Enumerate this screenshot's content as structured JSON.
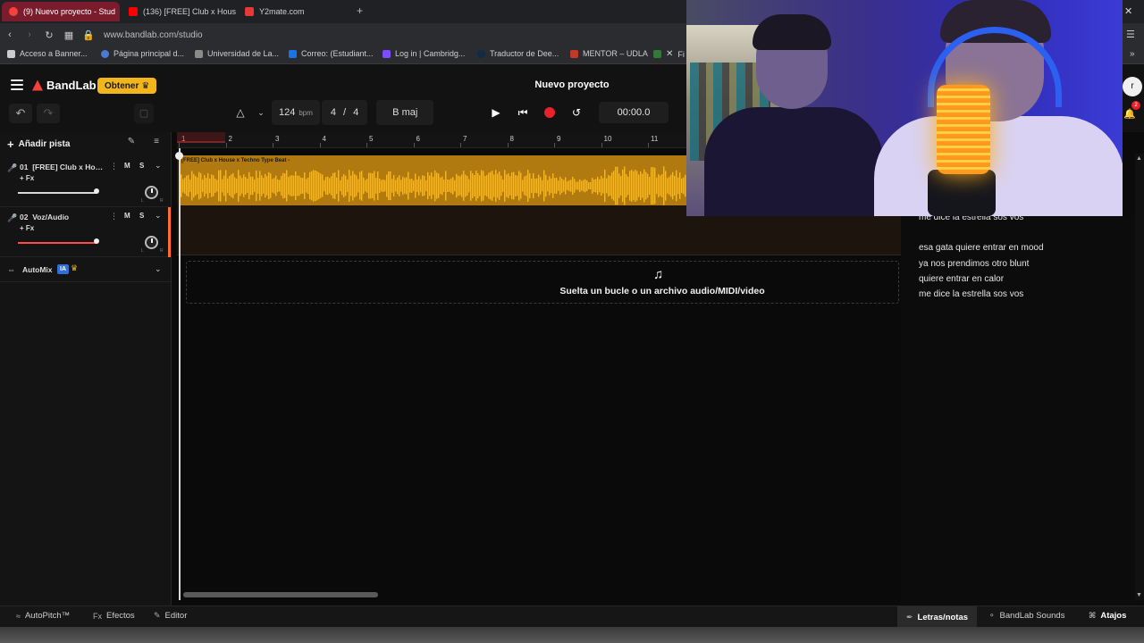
{
  "browser": {
    "tabs": [
      {
        "label": "(9) Nuevo proyecto - Stud",
        "active": true,
        "favicon_color": "#f4413a"
      },
      {
        "label": "(136) [FREE] Club x House",
        "active": false,
        "favicon_color": "#ff0000"
      },
      {
        "label": "Y2mate.com",
        "active": false,
        "favicon_color": "#e53935"
      }
    ],
    "new_tab": "+",
    "url": "www.bandlab.com/studio",
    "bookmarks": [
      {
        "label": "Acceso a Banner...",
        "icon_color": "#cccccc"
      },
      {
        "label": "Página principal d...",
        "icon_color": "#4a7bd0"
      },
      {
        "label": "Universidad de La...",
        "icon_color": "#8a8a8a"
      },
      {
        "label": "Correo: (Estudiant...",
        "icon_color": "#1b73e8"
      },
      {
        "label": "Log in | Cambridg...",
        "icon_color": "#7c4dff"
      },
      {
        "label": "Traductor de Dee...",
        "icon_color": "#0f2b46"
      },
      {
        "label": "MENTOR – UDLA",
        "icon_color": "#c0392b"
      },
      {
        "label": "Fi",
        "icon_color": "#2e7d32"
      }
    ]
  },
  "header": {
    "brand": "BandLab",
    "get_button": "Obtener",
    "project_title": "Nuevo proyecto",
    "tempo": "124",
    "tempo_unit": "bpm",
    "time_sig_num": "4",
    "time_sig_sep": "/",
    "time_sig_den": "4",
    "key": "B maj",
    "time": "00:00.0"
  },
  "tracks_panel": {
    "add_track": "Añadir pista",
    "tracks": [
      {
        "number": "01",
        "name": "[FREE] Club x Hous...",
        "fx": "+ Fx",
        "mute": "M",
        "solo": "S",
        "volume": 1.0,
        "color": "#f2b61b"
      },
      {
        "number": "02",
        "name": "Voz/Audio",
        "fx": "+ Fx",
        "mute": "M",
        "solo": "S",
        "volume": 1.0,
        "color": "#ff6a3a"
      }
    ],
    "automix": {
      "label": "AutoMix",
      "badge": "IA"
    },
    "pan_l": "L",
    "pan_r": "R"
  },
  "ruler": {
    "bars": [
      "1",
      "2",
      "3",
      "4",
      "5",
      "6",
      "7",
      "8",
      "9",
      "10",
      "11"
    ]
  },
  "clip": {
    "name": "[FREE] Club x House x Techno Type Beat -",
    "color": "#f2b61b"
  },
  "drop_zone": {
    "text": "Suelta un bucle o un archivo audio/MIDI/video"
  },
  "lyrics": {
    "lines": [
      "me dice la estrella sos vos",
      "esa gata quiere entrar en mood",
      "ya nos prendimos otro blunt",
      "quiere entrar en calor",
      "me dice la estrella sos vos"
    ]
  },
  "notifications": {
    "count": "2"
  },
  "bottom_bar": {
    "autopitch": "AutoPitch™",
    "effects": "Efectos",
    "effects_prefix": "Fx",
    "editor": "Editor",
    "lyrics": "Letras/notas",
    "sounds": "BandLab Sounds",
    "shortcuts": "Atajos"
  }
}
